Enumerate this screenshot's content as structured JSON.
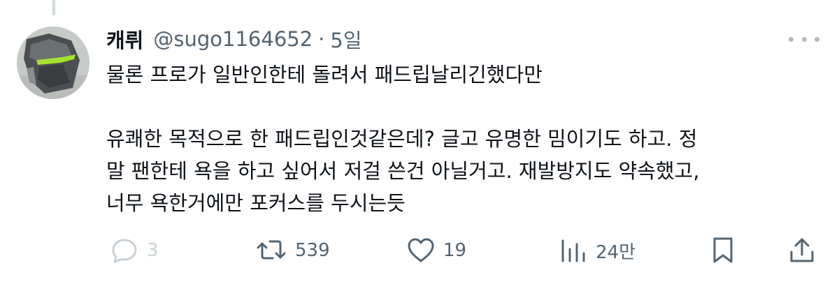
{
  "tweet": {
    "display_name": "캐뤼",
    "handle": "@sugo1164652",
    "separator": "·",
    "time": "5일",
    "text_line1": "물론 프로가 일반인한테 돌려서 패드립날리긴했다만",
    "text_para2": "유쾌한 목적으로 한 패드립인것같은데? 글고 유명한 밈이기도 하고. 정\n말 팬한테 욕을 하고 싶어서 저걸 쓴건 아닐거고. 재발방지도 약속했고,\n너무 욕한거에만 포커스를 두시는듯"
  },
  "actions": {
    "reply_count": "3",
    "retweet_count": "539",
    "like_count": "19",
    "views_count": "24만"
  },
  "icons": {
    "avatar": "robot-helmet-avatar",
    "more": "more-horizontal-icon",
    "reply": "reply-icon",
    "retweet": "retweet-icon",
    "like": "heart-icon",
    "views": "views-icon",
    "bookmark": "bookmark-icon",
    "share": "share-icon"
  },
  "colors": {
    "text": "#0f1419",
    "secondary": "#536471",
    "thread_line": "#cfd9de",
    "avatar_accent": "#a6e22e"
  }
}
